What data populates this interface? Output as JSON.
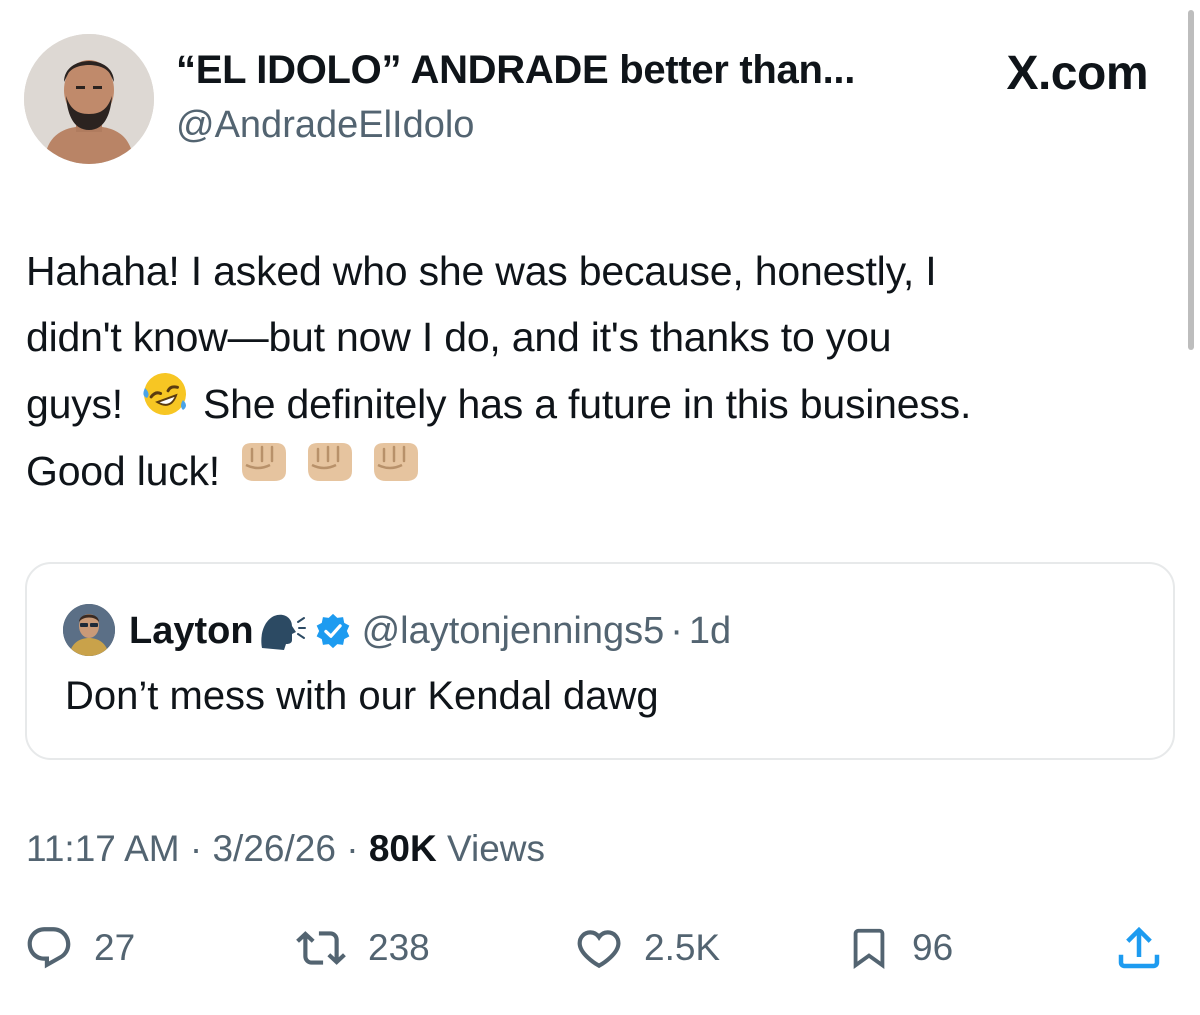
{
  "author": {
    "display_name": "“EL IDOLO” ANDRADE better than...",
    "handle": "@AndradeElIdolo"
  },
  "site_label": "X.com",
  "tweet": {
    "lines": [
      "Hahaha! I asked who she was because, honestly, I",
      "didn't know—but now I do, and it's thanks to you",
      "guys!",
      "She definitely has a future in this business.",
      "Good luck!"
    ]
  },
  "quoted_tweet": {
    "name": "Layton",
    "handle": "@laytonjennings5",
    "separator": "·",
    "age": "1d",
    "text": "Don’t mess with our Kendal dawg"
  },
  "meta": {
    "time": "11:17 AM",
    "sep1": "·",
    "date": "3/26/26",
    "sep2": "·",
    "views_count": "80K",
    "views_label": "Views"
  },
  "actions": {
    "replies": "27",
    "reposts": "238",
    "likes": "2.5K",
    "bookmarks": "96"
  },
  "icons": {
    "reply": "reply-bubble-icon",
    "repost": "repost-icon",
    "like": "heart-icon",
    "bookmark": "bookmark-icon",
    "share": "share-icon",
    "verified": "verified-badge-icon",
    "speaking": "speaking-head-icon",
    "laughing": "rolling-on-floor-laughing-emoji",
    "fist": "oncoming-fist-emoji"
  },
  "colors": {
    "text": "#0f1419",
    "secondary": "#536471",
    "verified": "#1d9bf0",
    "border": "#e7e9ea"
  }
}
